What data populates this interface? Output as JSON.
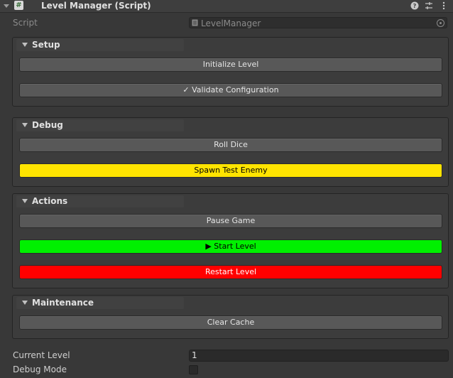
{
  "component": {
    "title": "Level Manager (Script)",
    "script_icon": "#"
  },
  "script_row": {
    "label": "Script",
    "value": "LevelManager"
  },
  "groups": [
    {
      "label": "Setup",
      "buttons": [
        {
          "label": "Initialize Level",
          "color": "#585858"
        },
        {
          "label": "✓ Validate Configuration",
          "color": "#585858"
        }
      ]
    },
    {
      "label": "Debug",
      "buttons": [
        {
          "label": "Roll Dice",
          "color": "#585858"
        },
        {
          "label": "Spawn Test Enemy",
          "color": "#ffe400"
        }
      ]
    },
    {
      "label": "Actions",
      "buttons": [
        {
          "label": "Pause Game",
          "color": "#585858"
        },
        {
          "label": "▶ Start Level",
          "color": "#00f000"
        },
        {
          "label": "Restart Level",
          "color": "#ff0000"
        }
      ]
    },
    {
      "label": "Maintenance",
      "buttons": [
        {
          "label": "Clear Cache",
          "color": "#585858"
        }
      ]
    }
  ],
  "fields": {
    "current_level": {
      "label": "Current Level",
      "value": "1"
    },
    "debug_mode": {
      "label": "Debug Mode",
      "checked": false
    }
  },
  "icons": {
    "fold": "chevron-down-icon",
    "help": "help-icon",
    "presets": "sliders-icon",
    "menu": "kebab-menu-icon",
    "file": "script-file-icon",
    "target": "object-picker-icon"
  }
}
